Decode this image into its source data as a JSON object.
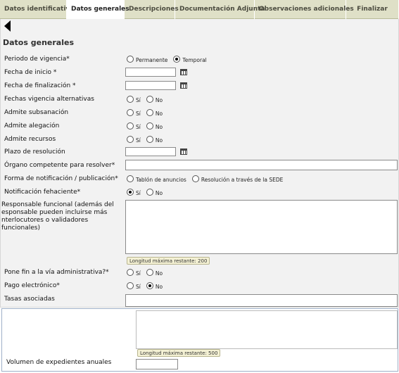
{
  "tabs": [
    "Datos identificativos",
    "Datos generales",
    "Descripciones",
    "Documentación Adjunta",
    "Observaciones adicionales",
    "Finalizar"
  ],
  "section_title": "Datos generales",
  "fields": {
    "periodo": {
      "label": "Periodo de vigencia*",
      "opt1": "Permanente",
      "opt2": "Temporal"
    },
    "inicio": {
      "label": "Fecha de inicio *"
    },
    "finalizacion": {
      "label": "Fecha de finalización *"
    },
    "alternativas": {
      "label": "Fechas vigencia alternativas",
      "si": "Sí",
      "no": "No"
    },
    "subsanacion": {
      "label": "Admite subsanación",
      "si": "Sí",
      "no": "No"
    },
    "alegacion": {
      "label": "Admite alegación",
      "si": "Sí",
      "no": "No"
    },
    "recursos": {
      "label": "Admite recursos",
      "si": "Sí",
      "no": "No"
    },
    "plazo": {
      "label": "Plazo de resolución"
    },
    "organo": {
      "label": "Órgano competente para resolver*"
    },
    "notificacion": {
      "label": "Forma de notificación / publicación*",
      "opt1": "Tablón de anuncios",
      "opt2": "Resolución a través de la SEDE"
    },
    "fehaciente": {
      "label": "Notificación fehaciente*",
      "si": "Sí",
      "no": "No"
    },
    "responsable": {
      "label": "Responsable funcional (además del esponsable pueden incluirse más nterlocutores o validadores funcionales)",
      "counter": "Longitud máxima restante: 200"
    },
    "pone_fin": {
      "label": "Pone fin a la vía administrativa?*",
      "si": "Sí",
      "no": "No"
    },
    "pago": {
      "label": "Pago electrónico*",
      "si": "Sí",
      "no": "No"
    },
    "tasas": {
      "label": "Tasas asociadas"
    }
  },
  "bottom": {
    "counter": "Longitud máxima restante: 500",
    "volumen_label": "Volumen de expedientes anuales"
  }
}
